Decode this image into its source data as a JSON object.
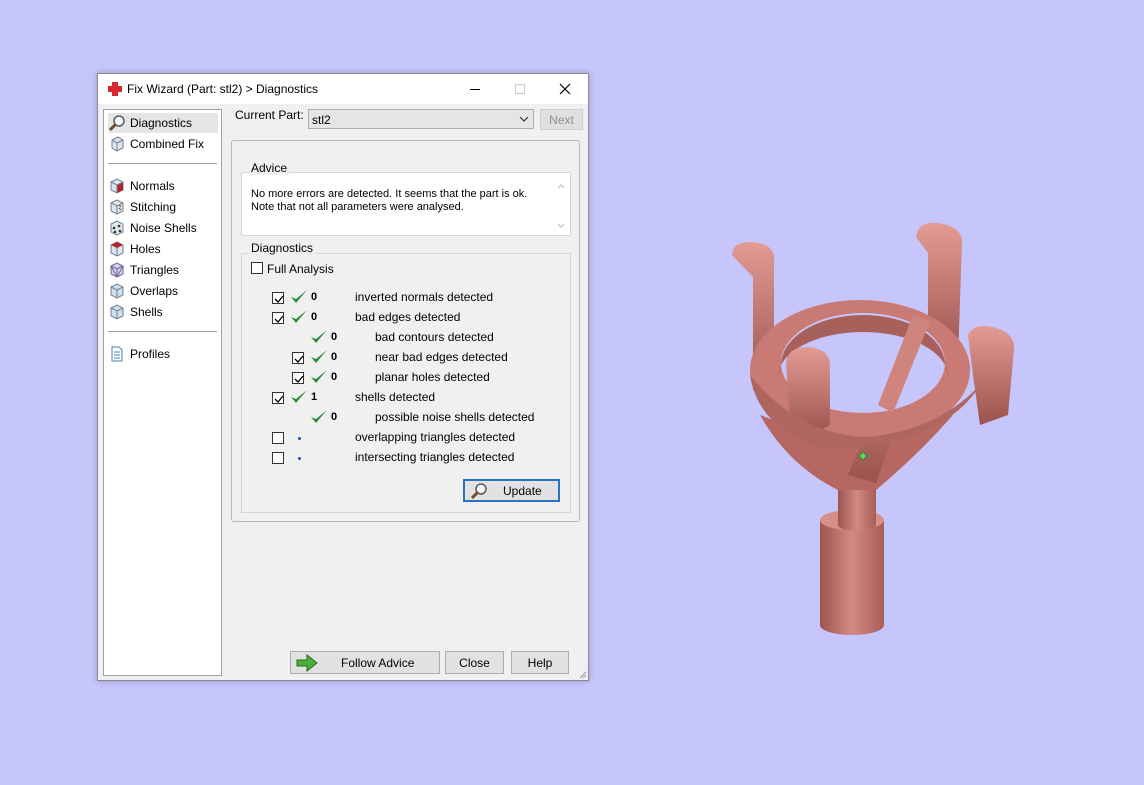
{
  "window": {
    "title": "Fix Wizard (Part: stl2) > Diagnostics"
  },
  "sidebar": {
    "items": [
      {
        "label": "Diagnostics",
        "icon": "magnifier-icon",
        "selected": true
      },
      {
        "label": "Combined Fix",
        "icon": "cube-icon"
      },
      {
        "label": "Normals",
        "icon": "normals-cube-icon"
      },
      {
        "label": "Stitching",
        "icon": "stitching-cube-icon"
      },
      {
        "label": "Noise Shells",
        "icon": "noise-shells-icon"
      },
      {
        "label": "Holes",
        "icon": "holes-cube-icon"
      },
      {
        "label": "Triangles",
        "icon": "triangles-cube-icon"
      },
      {
        "label": "Overlaps",
        "icon": "overlaps-cube-icon"
      },
      {
        "label": "Shells",
        "icon": "shells-cube-icon"
      },
      {
        "label": "Profiles",
        "icon": "document-icon"
      }
    ]
  },
  "header": {
    "current_part_label": "Current Part:",
    "current_part_value": "stl2",
    "next_label": "Next"
  },
  "advice": {
    "title": "Advice",
    "line1": "No more errors are detected. It seems that the part is ok.",
    "line2": "Note that not all parameters were analysed."
  },
  "diagnostics": {
    "title": "Diagnostics",
    "full_analysis_label": "Full Analysis",
    "full_analysis_checked": false,
    "rows": [
      {
        "checked": true,
        "status": "ok",
        "count": "0",
        "label": "inverted normals detected"
      },
      {
        "checked": true,
        "status": "ok",
        "count": "0",
        "label": "bad edges detected"
      },
      {
        "checked": null,
        "status": "ok",
        "count": "0",
        "label": "bad contours detected"
      },
      {
        "checked": true,
        "status": "ok",
        "count": "0",
        "label": "near bad edges detected"
      },
      {
        "checked": true,
        "status": "ok",
        "count": "0",
        "label": "planar holes detected"
      },
      {
        "checked": true,
        "status": "ok",
        "count": "1",
        "label": "shells detected"
      },
      {
        "checked": null,
        "status": "ok",
        "count": "0",
        "label": "possible noise shells detected"
      },
      {
        "checked": false,
        "status": "pending",
        "count": "",
        "label": "overlapping triangles detected"
      },
      {
        "checked": false,
        "status": "pending",
        "count": "",
        "label": "intersecting triangles detected"
      }
    ],
    "update_label": "Update"
  },
  "footer": {
    "follow_advice_label": "Follow Advice",
    "close_label": "Close",
    "help_label": "Help"
  },
  "colors": {
    "desktop": "#c6c6fc",
    "check_green": "#2e8b3e",
    "model": "#c77670",
    "accent_blue": "#2a72c6"
  }
}
